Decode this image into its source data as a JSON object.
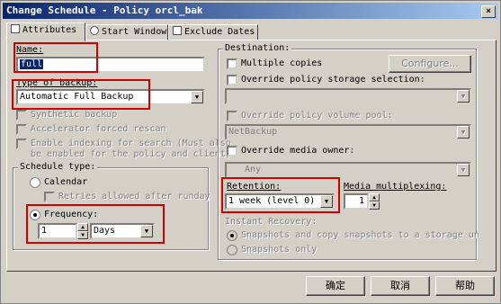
{
  "window": {
    "title": "Change Schedule - Policy orcl_bak",
    "close_glyph": "×"
  },
  "tabs": [
    {
      "label": "Attributes"
    },
    {
      "label": "Start Window"
    },
    {
      "label": "Exclude Dates"
    }
  ],
  "attributes": {
    "name_label": "Name:",
    "name_value": "full",
    "type_label": "Type of backup:",
    "type_value": "Automatic Full Backup",
    "synthetic_label": "Synthetic backup",
    "accelerator_label": "Accelerator forced rescan",
    "indexing_label_1": "Enable indexing for search (Must also",
    "indexing_label_2": "be enabled for the policy and client)",
    "schedule_type": {
      "group_label": "Schedule type:",
      "calendar_label": "Calendar",
      "retries_label": "Retries allowed after runday",
      "frequency_label": "Frequency:",
      "frequency_value": "1",
      "frequency_unit": "Days"
    }
  },
  "destination": {
    "group_label": "Destination:",
    "multiple_copies_label": "Multiple copies",
    "configure_label": "Configure...",
    "override_storage_label": "Override policy storage selection:",
    "storage_value": "",
    "override_pool_label": "Override policy volume pool:",
    "pool_value": "NetBackup",
    "override_media_label": "Override media owner:",
    "media_owner_value": "Any",
    "retention_label": "Retention:",
    "retention_value": "1 week (level 0)",
    "multiplexing_label": "Media multiplexing:",
    "multiplexing_value": "1",
    "instant_recovery_label": "Instant Recovery:",
    "snapshots_copy_label": "Snapshots and copy snapshots to a storage un",
    "snapshots_only_label": "Snapshots only"
  },
  "buttons": {
    "ok": "确定",
    "cancel": "取消",
    "help": "帮助"
  },
  "colors": {
    "titlebar": "#0a246a",
    "highlight": "#d00000",
    "face": "#d4d0c8"
  }
}
